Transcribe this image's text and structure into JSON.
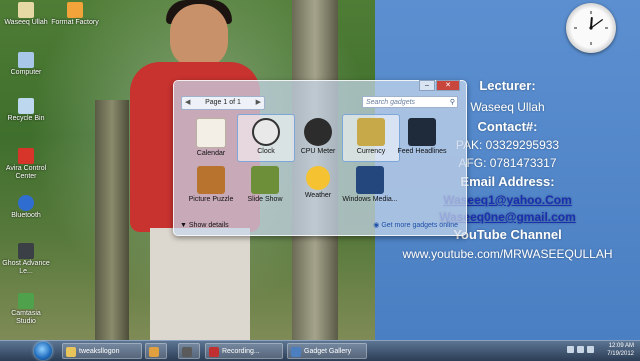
{
  "desktop_icons": [
    {
      "name": "desktop-icon-waseeq-ullah",
      "label": "Waseeq Ullah",
      "color": "#e7d9a5"
    },
    {
      "name": "desktop-icon-format-factory",
      "label": "Format Factory",
      "color": "#f2a33a"
    },
    {
      "name": "desktop-icon-computer",
      "label": "Computer",
      "color": "#a9c7e8"
    },
    {
      "name": "desktop-icon-recycle-bin",
      "label": "Recycle Bin",
      "color": "#bcd7ee"
    },
    {
      "name": "desktop-icon-avira-control-center",
      "label": "Avira Control Center",
      "color": "#d8352a"
    },
    {
      "name": "desktop-icon-bluetooth",
      "label": "Bluetooth",
      "color": "#2f6ed0"
    },
    {
      "name": "desktop-icon-ghost-advance",
      "label": "Ghost Advance Le...",
      "color": "#3b3f46"
    },
    {
      "name": "desktop-icon-camtasia-studio",
      "label": "Camtasia Studio",
      "color": "#4fa14b"
    }
  ],
  "info": {
    "lecturer_heading": "Lecturer:",
    "lecturer_name": "Waseeq Ullah",
    "contact_heading": "Contact#:",
    "phone1": "PAK: 03329295933",
    "phone2": "AFG: 0781473317",
    "email_heading": "Email Address:",
    "email1": "Waseeq1@yahoo.Com",
    "email2": "Waseeq0ne@gmail.com",
    "youtube_heading": "YouTube Channel",
    "youtube_url": "www.youtube.com/MRWASEEQULLAH"
  },
  "clock": {
    "hour": 12,
    "minute": 9
  },
  "gallery": {
    "page_label": "Page 1 of 1",
    "search_placeholder": "Search gadgets",
    "tiles": [
      {
        "label": "Calendar",
        "color": "#f3efe6"
      },
      {
        "label": "Clock",
        "color": "#e9e9e9"
      },
      {
        "label": "CPU Meter",
        "color": "#2c2c2c"
      },
      {
        "label": "Currency",
        "color": "#c8a94a"
      },
      {
        "label": "Feed Headlines",
        "color": "#1f2a3a"
      },
      {
        "label": "Picture Puzzle",
        "color": "#b8742e"
      },
      {
        "label": "Slide Show",
        "color": "#6e8f3a"
      },
      {
        "label": "Weather",
        "color": "#f5c232"
      },
      {
        "label": "Windows Media...",
        "color": "#24477d"
      }
    ],
    "show_details": "Show details",
    "get_more": "Get more gadgets online"
  },
  "taskbar": {
    "tasks": [
      {
        "label": "tweaksllogon",
        "color": "#e8c45a"
      },
      {
        "label": "",
        "color": "#e0a040"
      },
      {
        "label": "",
        "color": "#5a5a5a"
      },
      {
        "label": "Recording...",
        "color": "#c03030"
      },
      {
        "label": "Gadget Gallery",
        "color": "#4b7fc0"
      }
    ],
    "time": "12:09 AM",
    "date": "7/19/2012"
  }
}
